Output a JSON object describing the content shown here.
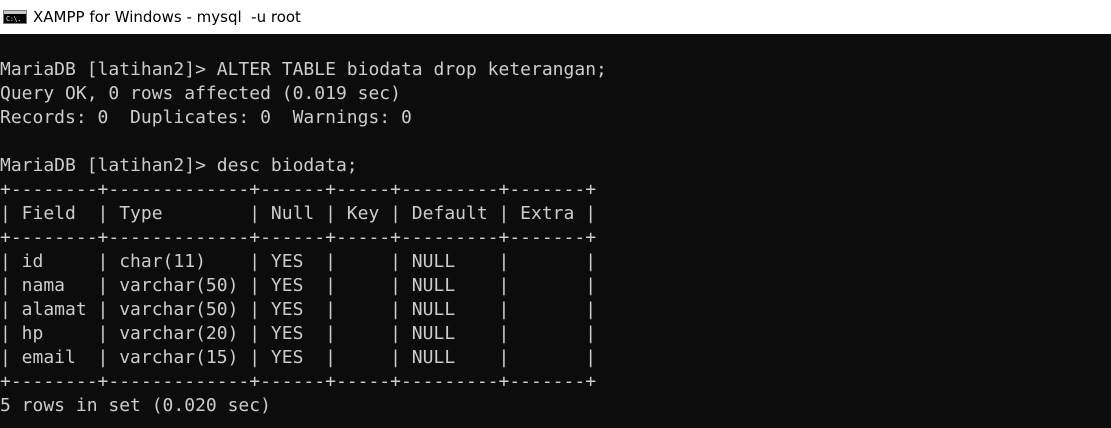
{
  "window": {
    "title": "XAMPP for Windows - mysql  -u root",
    "icon": "command-prompt-icon",
    "icon_text": "C:\\."
  },
  "terminal": {
    "colors": {
      "background": "#0c0c0c",
      "foreground": "#cccccc",
      "titlebar": "#ffffff"
    },
    "lines": [
      "MariaDB [latihan2]> ALTER TABLE biodata drop keterangan;",
      "Query OK, 0 rows affected (0.019 sec)",
      "Records: 0  Duplicates: 0  Warnings: 0",
      "",
      "MariaDB [latihan2]> desc biodata;",
      "+--------+-------------+------+-----+---------+-------+",
      "| Field  | Type        | Null | Key | Default | Extra |",
      "+--------+-------------+------+-----+---------+-------+",
      "| id     | char(11)    | YES  |     | NULL    |       |",
      "| nama   | varchar(50) | YES  |     | NULL    |       |",
      "| alamat | varchar(50) | YES  |     | NULL    |       |",
      "| hp     | varchar(20) | YES  |     | NULL    |       |",
      "| email  | varchar(15) | YES  |     | NULL    |       |",
      "+--------+-------------+------+-----+---------+-------+",
      "5 rows in set (0.020 sec)"
    ]
  }
}
